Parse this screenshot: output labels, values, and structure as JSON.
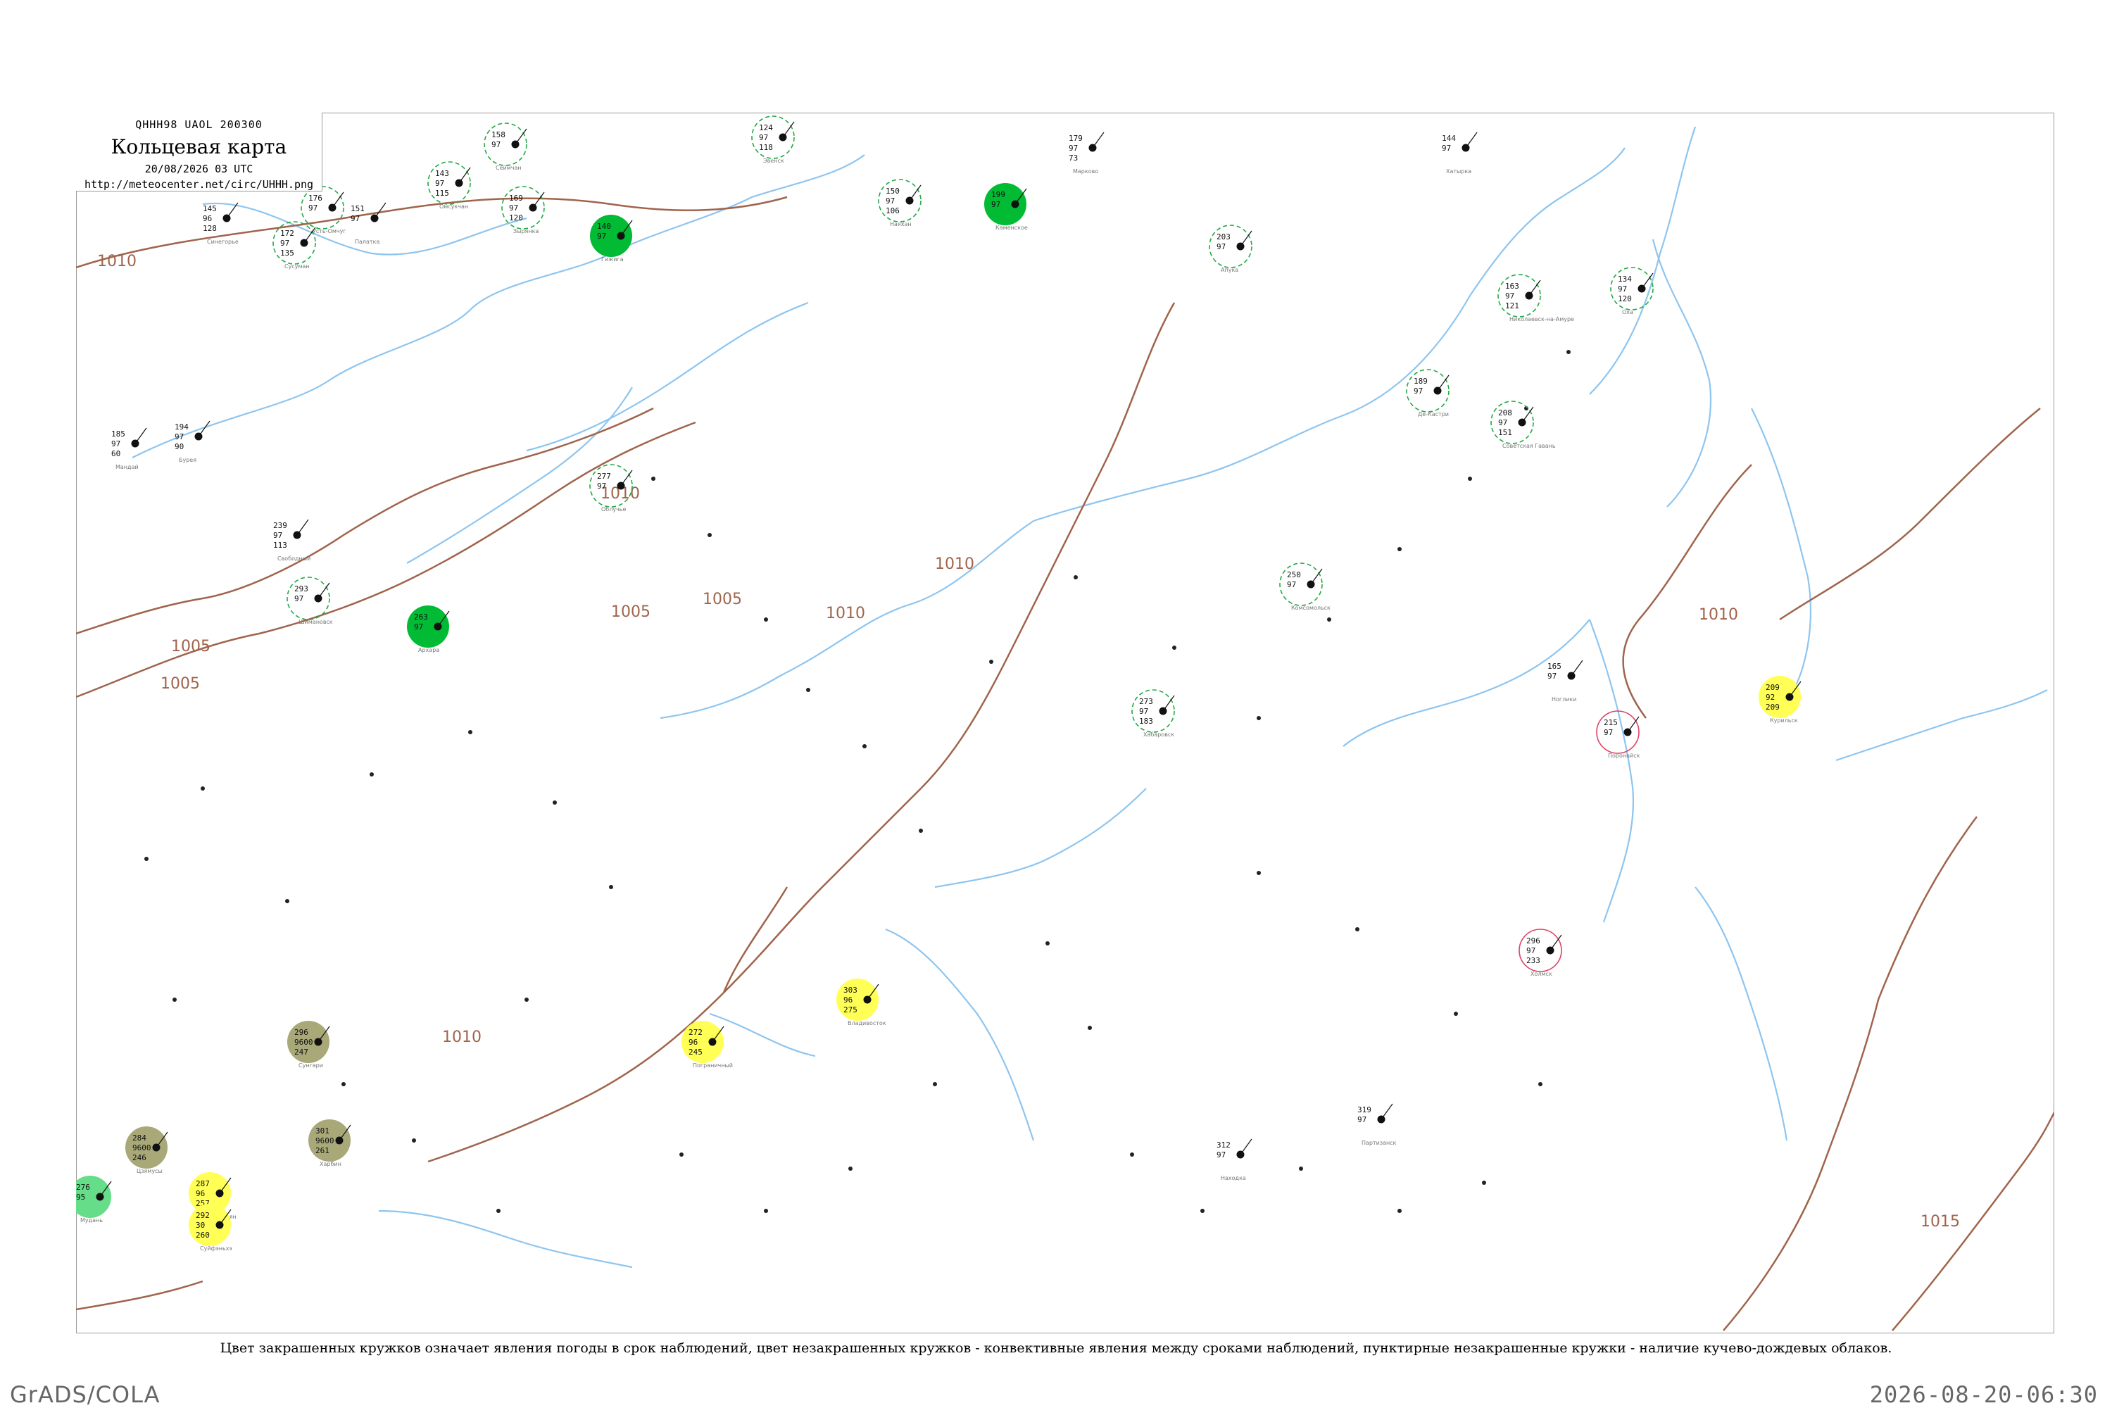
{
  "header": {
    "code": "QHHH98  UAOL  200300",
    "title": "Кольцевая карта",
    "datetime": "20/08/2026 03 UTC",
    "url": "http://meteocenter.net/circ/UHHH.png"
  },
  "caption": "Цвет закрашенных кружков означает явления погоды в срок наблюдений, цвет незакрашенных кружков - конвективные явления между сроками наблюдений, пунктирные незакрашенные кружки - наличие кучево-дождевых облаков.",
  "footer": {
    "left": "GrADS/COLA",
    "right": "2026-08-20-06:30"
  },
  "colors": {
    "isobar": "#a0644c",
    "river": "#8ec5ef",
    "rain_green": "#00bb33",
    "thunder_light_green": "#66dd88",
    "fog_olive": "#a8a878",
    "haze_yellow": "#ffff55",
    "cb_dashed": "#22aa44",
    "convective_red": "#dd4466"
  },
  "isobar_labels": [
    "1010",
    "1005",
    "1005",
    "1005",
    "1010",
    "1010",
    "1005",
    "1010",
    "1010",
    "1010",
    "1015"
  ],
  "stations": [
    {
      "id": "s1",
      "l1": "145",
      "l2": "96",
      "l3": "128",
      "color": "none",
      "name": "Синегорье"
    },
    {
      "id": "s2",
      "l1": "172",
      "l2": "97",
      "l3": "135",
      "color": "cb",
      "name": "Сусуман"
    },
    {
      "id": "s3",
      "l1": "176",
      "l2": "97",
      "l3": "",
      "color": "cb",
      "name": "Усть-Омчуг"
    },
    {
      "id": "s4",
      "l1": "151",
      "l2": "97",
      "l3": "",
      "color": "none",
      "name": "Палатка"
    },
    {
      "id": "s5",
      "l1": "143",
      "l2": "97",
      "l3": "115",
      "color": "cb",
      "name": "Омсукчан"
    },
    {
      "id": "s6",
      "l1": "158",
      "l2": "97",
      "l3": "",
      "color": "cb",
      "name": "Сеймчан"
    },
    {
      "id": "s7",
      "l1": "169",
      "l2": "97",
      "l3": "120",
      "color": "cb",
      "name": "Зырянка"
    },
    {
      "id": "s8",
      "l1": "140",
      "l2": "97",
      "l3": "",
      "color": "rain",
      "name": "Гижига"
    },
    {
      "id": "s9",
      "l1": "124",
      "l2": "97",
      "l3": "118",
      "color": "cb",
      "name": "Эвенск"
    },
    {
      "id": "s10",
      "l1": "150",
      "l2": "97",
      "l3": "106",
      "color": "cb",
      "name": "Наяхан"
    },
    {
      "id": "s11",
      "l1": "199",
      "l2": "97",
      "l3": "",
      "color": "rain",
      "name": "Каменское"
    },
    {
      "id": "s12",
      "l1": "179",
      "l2": "97",
      "l3": "73",
      "color": "none",
      "name": "Марково"
    },
    {
      "id": "s13",
      "l1": "203",
      "l2": "97",
      "l3": "",
      "color": "cb",
      "name": "Апука"
    },
    {
      "id": "s14",
      "l1": "144",
      "l2": "97",
      "l3": "",
      "color": "none",
      "name": "Хатырка"
    },
    {
      "id": "s15",
      "l1": "185",
      "l2": "97",
      "l3": "60",
      "color": "none",
      "name": "Мандай"
    },
    {
      "id": "s16",
      "l1": "194",
      "l2": "97",
      "l3": "90",
      "color": "none",
      "name": "Бурея"
    },
    {
      "id": "s17",
      "l1": "239",
      "l2": "97",
      "l3": "113",
      "color": "none",
      "name": "Свободный"
    },
    {
      "id": "s18",
      "l1": "293",
      "l2": "97",
      "l3": "",
      "color": "cb",
      "name": "Шимановск"
    },
    {
      "id": "s19",
      "l1": "263",
      "l2": "97",
      "l3": "",
      "color": "rain",
      "name": "Архара"
    },
    {
      "id": "s20",
      "l1": "277",
      "l2": "97",
      "l3": "",
      "color": "cb",
      "name": "Облучье"
    },
    {
      "id": "s21",
      "l1": "296",
      "l2": "9600",
      "l3": "247",
      "color": "fog",
      "name": "Сунгари"
    },
    {
      "id": "s22",
      "l1": "301",
      "l2": "9600",
      "l3": "261",
      "color": "fog",
      "name": "Харбин"
    },
    {
      "id": "s23",
      "l1": "284",
      "l2": "9600",
      "l3": "246",
      "color": "fog",
      "name": "Цзямусы"
    },
    {
      "id": "s24",
      "l1": "276",
      "l2": "95",
      "l3": "",
      "color": "lightgreen",
      "name": "Мудань"
    },
    {
      "id": "s25",
      "l1": "287",
      "l2": "96",
      "l3": "257",
      "color": "haze",
      "name": "Муданьцзян"
    },
    {
      "id": "s26",
      "l1": "292",
      "l2": "30",
      "l3": "260",
      "color": "haze",
      "name": "Суйфэньхэ"
    },
    {
      "id": "s27",
      "l1": "272",
      "l2": "96",
      "l3": "245",
      "color": "haze",
      "name": "Пограничный"
    },
    {
      "id": "s28",
      "l1": "303",
      "l2": "96",
      "l3": "275",
      "color": "haze",
      "name": "Владивосток"
    },
    {
      "id": "s29",
      "l1": "209",
      "l2": "92",
      "l3": "209",
      "color": "haze",
      "name": "Курильск"
    },
    {
      "id": "s30",
      "l1": "296",
      "l2": "97",
      "l3": "233",
      "color": "convective",
      "name": "Холмск"
    },
    {
      "id": "s31",
      "l1": "215",
      "l2": "97",
      "l3": "",
      "color": "convective",
      "name": "Поронайск"
    },
    {
      "id": "s32",
      "l1": "165",
      "l2": "97",
      "l3": "",
      "color": "none",
      "name": "Ноглики"
    },
    {
      "id": "s33",
      "l1": "134",
      "l2": "97",
      "l3": "120",
      "color": "cb",
      "name": "Оха"
    },
    {
      "id": "s34",
      "l1": "163",
      "l2": "97",
      "l3": "121",
      "color": "cb",
      "name": "Николаевск-на-Амуре"
    },
    {
      "id": "s35",
      "l1": "189",
      "l2": "97",
      "l3": "",
      "color": "cb",
      "name": "Де-Кастри"
    },
    {
      "id": "s36",
      "l1": "208",
      "l2": "97",
      "l3": "151",
      "color": "cb",
      "name": "Советская Гавань"
    },
    {
      "id": "s37",
      "l1": "250",
      "l2": "97",
      "l3": "",
      "color": "cb",
      "name": "Комсомольск"
    },
    {
      "id": "s38",
      "l1": "273",
      "l2": "97",
      "l3": "183",
      "color": "cb",
      "name": "Хабаровск"
    },
    {
      "id": "s39",
      "l1": "312",
      "l2": "97",
      "l3": "",
      "color": "none",
      "name": "Находка"
    },
    {
      "id": "s40",
      "l1": "319",
      "l2": "97",
      "l3": "",
      "color": "none",
      "name": "Партизанск"
    }
  ]
}
